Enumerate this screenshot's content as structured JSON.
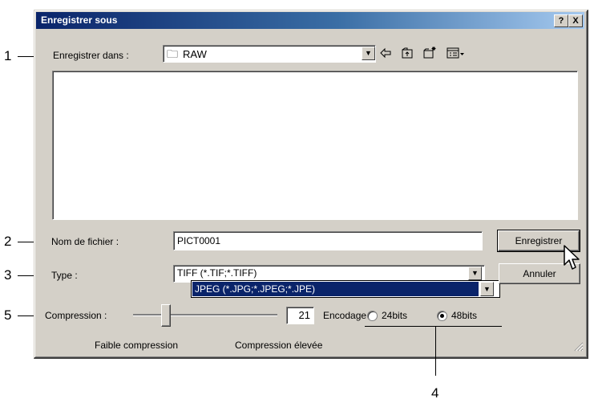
{
  "window": {
    "title": "Enregistrer sous",
    "help_button": "?",
    "close_button": "X"
  },
  "callouts": [
    "1",
    "2",
    "3",
    "5",
    "4"
  ],
  "save_in": {
    "label": "Enregistrer dans :",
    "value": "RAW"
  },
  "toolbar_icons": [
    "back-arrow-icon",
    "up-folder-icon",
    "new-folder-icon",
    "view-menu-icon"
  ],
  "filename": {
    "label": "Nom de fichier :",
    "value": "PICT0001"
  },
  "type": {
    "label": "Type :",
    "value": "TIFF (*.TIF;*.TIFF)",
    "highlighted_option": "JPEG (*.JPG;*.JPEG;*.JPE)"
  },
  "buttons": {
    "save": "Enregistrer",
    "cancel": "Annuler"
  },
  "compression": {
    "label": "Compression :",
    "value": "21",
    "min_label": "Faible compression",
    "max_label": "Compression élevée",
    "slider_fraction": 0.26
  },
  "encoding": {
    "label": "Encodage",
    "options": [
      "24bits",
      "48bits"
    ],
    "selected": "48bits"
  }
}
